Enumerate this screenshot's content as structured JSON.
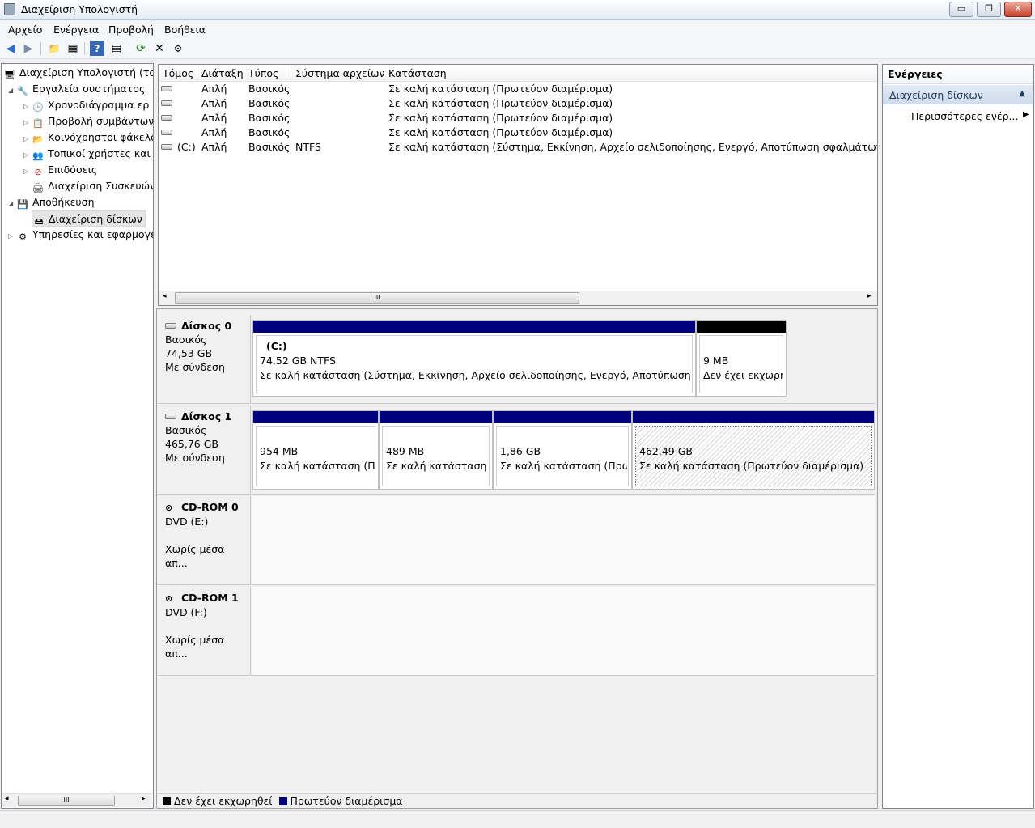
{
  "window": {
    "title": "Διαχείριση Υπολογιστή",
    "minimize": "▭",
    "maximize": "❐",
    "close": "✕"
  },
  "menu": [
    "Αρχείο",
    "Ενέργεια",
    "Προβολή",
    "Βοήθεια"
  ],
  "toolbar": {
    "back": "◀",
    "forward": "▶",
    "up": "📁",
    "view": "▦",
    "help": "?",
    "view2": "▤",
    "refresh": "⟳",
    "delete": "✕",
    "properties": "⚙"
  },
  "tree": [
    {
      "label": "Διαχείριση Υπολογιστή (τοπ",
      "icon": "computer-icon",
      "glyph": "🖥",
      "tri": ""
    },
    {
      "label": "Εργαλεία συστήματος",
      "icon": "tools-icon",
      "glyph": "🔧",
      "tri": "◢"
    },
    {
      "label": "Χρονοδιάγραμμα ερ",
      "icon": "clock-icon",
      "glyph": "🕒",
      "tri": "▷"
    },
    {
      "label": "Προβολή συμβάντων",
      "icon": "event-viewer-icon",
      "glyph": "📋",
      "tri": "▷"
    },
    {
      "label": "Κοινόχρηστοι φάκελο",
      "icon": "shared-folder-icon",
      "glyph": "📂",
      "tri": "▷"
    },
    {
      "label": "Τοπικοί χρήστες και ο",
      "icon": "users-icon",
      "glyph": "👥",
      "tri": "▷"
    },
    {
      "label": "Επιδόσεις",
      "icon": "performance-icon",
      "glyph": "⊘",
      "tri": "▷"
    },
    {
      "label": "Διαχείριση Συσκευών",
      "icon": "device-manager-icon",
      "glyph": "🖨",
      "tri": ""
    },
    {
      "label": "Αποθήκευση",
      "icon": "storage-icon",
      "glyph": "💾",
      "tri": "◢"
    },
    {
      "label": "Διαχείριση δίσκων",
      "icon": "disk-management-icon",
      "glyph": "🖴",
      "tri": ""
    },
    {
      "label": "Υπηρεσίες και εφαρμογέ",
      "icon": "services-icon",
      "glyph": "⚙",
      "tri": "▷"
    }
  ],
  "tree_scroll": "III",
  "list": {
    "columns": [
      "Τόμος",
      "Διάταξη",
      "Τύπος",
      "Σύστημα αρχείων",
      "Κατάσταση"
    ],
    "rows": [
      {
        "volume": "",
        "layout": "Απλή",
        "type": "Βασικός",
        "fs": "",
        "status": "Σε καλή κατάσταση (Πρωτεύον διαμέρισμα)"
      },
      {
        "volume": "",
        "layout": "Απλή",
        "type": "Βασικός",
        "fs": "",
        "status": "Σε καλή κατάσταση (Πρωτεύον διαμέρισμα)"
      },
      {
        "volume": "",
        "layout": "Απλή",
        "type": "Βασικός",
        "fs": "",
        "status": "Σε καλή κατάσταση (Πρωτεύον διαμέρισμα)"
      },
      {
        "volume": "",
        "layout": "Απλή",
        "type": "Βασικός",
        "fs": "",
        "status": "Σε καλή κατάσταση (Πρωτεύον διαμέρισμα)"
      },
      {
        "volume": "(C:)",
        "layout": "Απλή",
        "type": "Βασικός",
        "fs": "NTFS",
        "status": "Σε καλή κατάσταση (Σύστημα, Εκκίνηση, Αρχείο σελιδοποίησης, Ενεργό, Αποτύπωση σφαλμάτων, Πρωτ"
      }
    ],
    "scroll_left": "◂",
    "scroll_right": "▸",
    "scroll_thumb": "III"
  },
  "disks": [
    {
      "name": "Δίσκος 0",
      "type": "Βασικός",
      "size": "74,53 GB",
      "state": "Με σύνδεση",
      "partitions": [
        {
          "label": "(C:)",
          "size": "74,52 GB NTFS",
          "status": "Σε καλή κατάσταση (Σύστημα, Εκκίνηση, Αρχείο σελιδοποίησης, Ενεργό, Αποτύπωση σφαλμ",
          "bar_color": "#00007f"
        },
        {
          "label": "",
          "size": "9 MB",
          "status": "Δεν έχει εκχωρη",
          "bar_color": "#000000"
        }
      ]
    },
    {
      "name": "Δίσκος 1",
      "type": "Βασικός",
      "size": "465,76 GB",
      "state": "Με σύνδεση",
      "partitions": [
        {
          "label": "",
          "size": "954 MB",
          "status": "Σε καλή κατάσταση (Πρω",
          "bar_color": "#00007f"
        },
        {
          "label": "",
          "size": "489 MB",
          "status": "Σε καλή κατάσταση (Γ",
          "bar_color": "#00007f"
        },
        {
          "label": "",
          "size": "1,86 GB",
          "status": "Σε καλή κατάσταση (Πρωτ",
          "bar_color": "#00007f"
        },
        {
          "label": "",
          "size": "462,49 GB",
          "status": "Σε καλή κατάσταση (Πρωτεύον διαμέρισμα)",
          "bar_color": "#00007f"
        }
      ]
    },
    {
      "name": "CD-ROM 0",
      "type": "DVD (E:)",
      "size": "",
      "state": "Χωρίς μέσα απ..."
    },
    {
      "name": "CD-ROM 1",
      "type": "DVD (F:)",
      "size": "",
      "state": "Χωρίς μέσα απ..."
    }
  ],
  "legend": [
    {
      "label": "Δεν έχει εκχωρηθεί",
      "color": "#000000"
    },
    {
      "label": "Πρωτεύον διαμέρισμα",
      "color": "#00007f"
    }
  ],
  "actions": {
    "header": "Ενέργειες",
    "section": "Διαχείριση δίσκων",
    "more": "Περισσότερες ενέρ...",
    "collapse_arrow": "▲",
    "more_arrow": "▶"
  }
}
